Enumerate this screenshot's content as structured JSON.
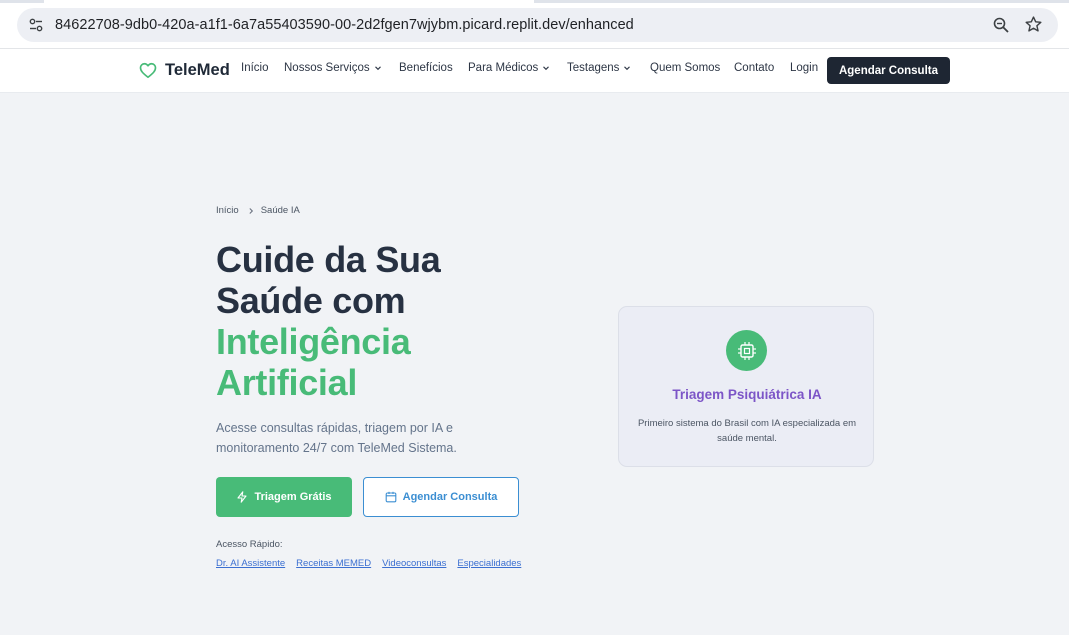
{
  "browser": {
    "url": "84622708-9db0-420a-a1f1-6a7a55403590-00-2d2fgen7wjybm.picard.replit.dev/enhanced",
    "icons": [
      "site-settings-icon",
      "zoom-icon",
      "bookmark-star-icon"
    ]
  },
  "header": {
    "brand": "TeleMed",
    "nav": {
      "inicio": "Início",
      "servicos": "Nossos Serviços",
      "beneficios": "Benefícios",
      "medicos": "Para Médicos",
      "testagens": "Testagens",
      "quem_somos": "Quem Somos",
      "contato": "Contato",
      "login": "Login"
    },
    "cta": "Agendar Consulta"
  },
  "breadcrumb": {
    "home": "Início",
    "current": "Saúde IA"
  },
  "hero": {
    "title_line1": "Cuide da Sua",
    "title_line2": "Saúde com",
    "title_line3": "Inteligência",
    "title_line4": "Artificial",
    "subtitle": "Acesse consultas rápidas, triagem por IA e monitoramento 24/7 com TeleMed Sistema.",
    "primary_button": "Triagem Grátis",
    "secondary_button": "Agendar Consulta",
    "quick_access_label": "Acesso Rápido:",
    "quick_links": [
      "Dr. AI Assistente",
      "Receitas MEMED",
      "Videoconsultas",
      "Especialidades"
    ]
  },
  "card": {
    "title": "Triagem Psiquiátrica IA",
    "description": "Primeiro sistema do Brasil com IA especializada em saúde mental."
  },
  "colors": {
    "accent_green": "#48bb78",
    "dark": "#1e2633",
    "link_blue": "#3b8ed2",
    "purple": "#7c55c7"
  }
}
